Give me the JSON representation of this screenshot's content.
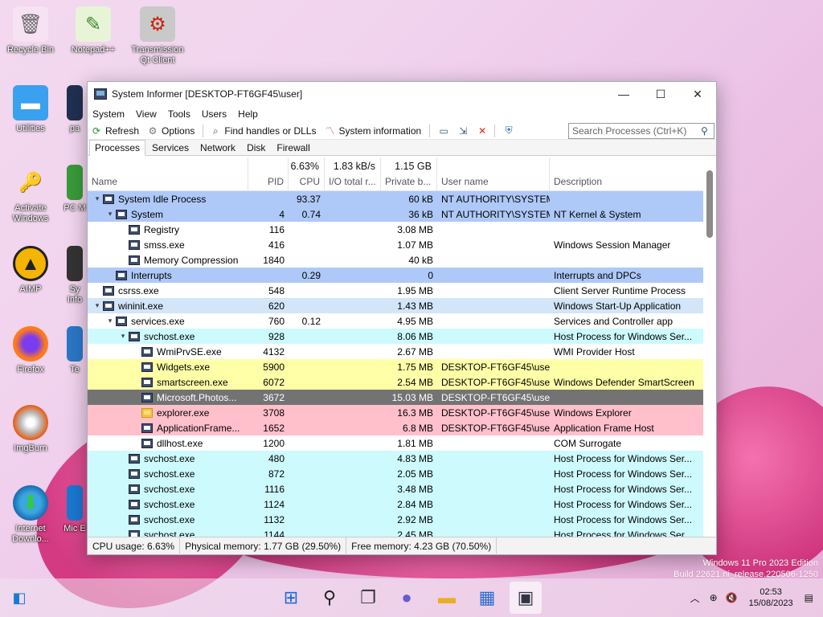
{
  "desktop": {
    "icons": [
      {
        "label": "Recycle Bin",
        "icon": "recycle-bin"
      },
      {
        "label": "Notepad++",
        "icon": "notepad-plus-plus"
      },
      {
        "label": "Transmission Qt Client",
        "icon": "transmission"
      },
      {
        "label": "Utilities",
        "icon": "folder"
      },
      {
        "label": "pa",
        "icon": "app"
      },
      {
        "label": "Activate Windows",
        "icon": "key"
      },
      {
        "label": "PC M",
        "icon": "app"
      },
      {
        "label": "AIMP",
        "icon": "aimp"
      },
      {
        "label": "Sy Info",
        "icon": "app"
      },
      {
        "label": "Firefox",
        "icon": "firefox"
      },
      {
        "label": "Te",
        "icon": "app"
      },
      {
        "label": "ImgBurn",
        "icon": "imgburn"
      },
      {
        "label": "Internet Downlo...",
        "icon": "idm"
      },
      {
        "label": "Mic E",
        "icon": "app"
      }
    ]
  },
  "window": {
    "title": "System Informer [DESKTOP-FT6GF45\\user]",
    "controls": {
      "minimize": "—",
      "maximize": "☐",
      "close": "✕"
    },
    "menu": [
      "System",
      "View",
      "Tools",
      "Users",
      "Help"
    ],
    "toolbar": {
      "refresh": "Refresh",
      "options": "Options",
      "find_handles": "Find handles or DLLs",
      "system_information": "System information"
    },
    "search": {
      "placeholder": "Search Processes (Ctrl+K)"
    },
    "tabs": [
      "Processes",
      "Services",
      "Network",
      "Disk",
      "Firewall"
    ],
    "active_tab": "Processes",
    "columns": {
      "name": "Name",
      "pid": "PID",
      "cpu": "CPU",
      "io": "I/O total r...",
      "private": "Private b...",
      "user": "User name",
      "description": "Description"
    },
    "totals": {
      "cpu": "6.63%",
      "io": "1.83 kB/s",
      "private": "1.15 GB"
    },
    "processes": [
      {
        "name": "System Idle Process",
        "indent": 0,
        "arrow": "▾",
        "pid": "",
        "cpu": "93.37",
        "priv": "60 kB",
        "user": "NT AUTHORITY\\SYSTEM",
        "desc": "",
        "bg": "blue"
      },
      {
        "name": "System",
        "indent": 1,
        "arrow": "▾",
        "pid": "4",
        "cpu": "0.74",
        "priv": "36 kB",
        "user": "NT AUTHORITY\\SYSTEM",
        "desc": "NT Kernel & System",
        "bg": "blue"
      },
      {
        "name": "Registry",
        "indent": 2,
        "arrow": "",
        "pid": "116",
        "cpu": "",
        "priv": "3.08 MB",
        "user": "",
        "desc": "",
        "bg": "white"
      },
      {
        "name": "smss.exe",
        "indent": 2,
        "arrow": "",
        "pid": "416",
        "cpu": "",
        "priv": "1.07 MB",
        "user": "",
        "desc": "Windows Session Manager",
        "bg": "white"
      },
      {
        "name": "Memory Compression",
        "indent": 2,
        "arrow": "",
        "pid": "1840",
        "cpu": "",
        "priv": "40 kB",
        "user": "",
        "desc": "",
        "bg": "white"
      },
      {
        "name": "Interrupts",
        "indent": 1,
        "arrow": "",
        "pid": "",
        "cpu": "0.29",
        "priv": "0",
        "user": "",
        "desc": "Interrupts and DPCs",
        "bg": "blue"
      },
      {
        "name": "csrss.exe",
        "indent": 0,
        "arrow": "",
        "pid": "548",
        "cpu": "",
        "priv": "1.95 MB",
        "user": "",
        "desc": "Client Server Runtime Process",
        "bg": "white"
      },
      {
        "name": "wininit.exe",
        "indent": 0,
        "arrow": "▾",
        "pid": "620",
        "cpu": "",
        "priv": "1.43 MB",
        "user": "",
        "desc": "Windows Start-Up Application",
        "bg": "lblue"
      },
      {
        "name": "services.exe",
        "indent": 1,
        "arrow": "▾",
        "pid": "760",
        "cpu": "0.12",
        "priv": "4.95 MB",
        "user": "",
        "desc": "Services and Controller app",
        "bg": "white"
      },
      {
        "name": "svchost.exe",
        "indent": 2,
        "arrow": "▾",
        "pid": "928",
        "cpu": "",
        "priv": "8.06 MB",
        "user": "",
        "desc": "Host Process for Windows Ser...",
        "bg": "cyan"
      },
      {
        "name": "WmiPrvSE.exe",
        "indent": 3,
        "arrow": "",
        "pid": "4132",
        "cpu": "",
        "priv": "2.67 MB",
        "user": "",
        "desc": "WMI Provider Host",
        "bg": "white"
      },
      {
        "name": "Widgets.exe",
        "indent": 3,
        "arrow": "",
        "pid": "5900",
        "cpu": "",
        "priv": "1.75 MB",
        "user": "DESKTOP-FT6GF45\\user",
        "desc": "",
        "bg": "yellow"
      },
      {
        "name": "smartscreen.exe",
        "indent": 3,
        "arrow": "",
        "pid": "6072",
        "cpu": "",
        "priv": "2.54 MB",
        "user": "DESKTOP-FT6GF45\\user",
        "desc": "Windows Defender SmartScreen",
        "bg": "yellow"
      },
      {
        "name": "Microsoft.Photos...",
        "indent": 3,
        "arrow": "",
        "pid": "3672",
        "cpu": "",
        "priv": "15.03 MB",
        "user": "DESKTOP-FT6GF45\\user",
        "desc": "",
        "bg": "dark"
      },
      {
        "name": "explorer.exe",
        "indent": 3,
        "arrow": "",
        "pid": "3708",
        "cpu": "",
        "priv": "16.3 MB",
        "user": "DESKTOP-FT6GF45\\user",
        "desc": "Windows Explorer",
        "bg": "pink",
        "icon": "folder"
      },
      {
        "name": "ApplicationFrame...",
        "indent": 3,
        "arrow": "",
        "pid": "1652",
        "cpu": "",
        "priv": "6.8 MB",
        "user": "DESKTOP-FT6GF45\\user",
        "desc": "Application Frame Host",
        "bg": "pink"
      },
      {
        "name": "dllhost.exe",
        "indent": 3,
        "arrow": "",
        "pid": "1200",
        "cpu": "",
        "priv": "1.81 MB",
        "user": "",
        "desc": "COM Surrogate",
        "bg": "white"
      },
      {
        "name": "svchost.exe",
        "indent": 2,
        "arrow": "",
        "pid": "480",
        "cpu": "",
        "priv": "4.83 MB",
        "user": "",
        "desc": "Host Process for Windows Ser...",
        "bg": "cyan"
      },
      {
        "name": "svchost.exe",
        "indent": 2,
        "arrow": "",
        "pid": "872",
        "cpu": "",
        "priv": "2.05 MB",
        "user": "",
        "desc": "Host Process for Windows Ser...",
        "bg": "cyan"
      },
      {
        "name": "svchost.exe",
        "indent": 2,
        "arrow": "",
        "pid": "1116",
        "cpu": "",
        "priv": "3.48 MB",
        "user": "",
        "desc": "Host Process for Windows Ser...",
        "bg": "cyan"
      },
      {
        "name": "svchost.exe",
        "indent": 2,
        "arrow": "",
        "pid": "1124",
        "cpu": "",
        "priv": "2.84 MB",
        "user": "",
        "desc": "Host Process for Windows Ser...",
        "bg": "cyan"
      },
      {
        "name": "svchost.exe",
        "indent": 2,
        "arrow": "",
        "pid": "1132",
        "cpu": "",
        "priv": "2.92 MB",
        "user": "",
        "desc": "Host Process for Windows Ser...",
        "bg": "cyan"
      },
      {
        "name": "svchost.exe",
        "indent": 2,
        "arrow": "",
        "pid": "1144",
        "cpu": "",
        "priv": "2.45 MB",
        "user": "",
        "desc": "Host Process for Windows Ser...",
        "bg": "cyan"
      }
    ],
    "status": {
      "cpu": "CPU usage: 6.63%",
      "physical": "Physical memory: 1.77 GB (29.50%)",
      "free": "Free memory: 4.23 GB (70.50%)"
    }
  },
  "watermark": {
    "line1": "Windows 11 Pro 2023 Edition",
    "line2": "Build 22621.ni_release.220506-1250"
  },
  "taskbar": {
    "apps": [
      "start",
      "search",
      "task-view",
      "teams",
      "file-explorer",
      "store",
      "system-informer"
    ],
    "clock": {
      "time": "02:53",
      "date": "15/08/2023"
    }
  }
}
